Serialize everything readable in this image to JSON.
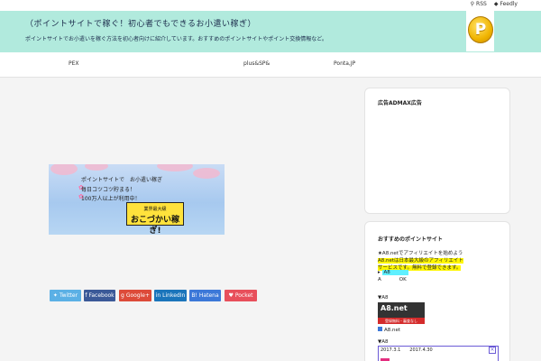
{
  "topbar": {
    "rss_label": "RSS",
    "feedly_label": "Feedly"
  },
  "header": {
    "site_title": "（ポイントサイトで稼ぐ！初心者でもできるお小遣い稼ぎ）",
    "site_description": "ポイントサイトでお小遣いを稼ぐ方法を初心者向けに紹介しています。おすすめのポイントサイトやポイント交換情報など。"
  },
  "nav": {
    "items": [
      "PEX",
      "plus&SP&",
      "Ponta,JP"
    ]
  },
  "banner": {
    "line1": "ポイントサイトで　お小遣い稼ぎ",
    "line2": "毎日コツコツ貯まる！",
    "line3": "100万人以上が利用中！",
    "badge_line1": "業界最大級",
    "badge_line2": "おこづかい稼ぎ!"
  },
  "share": {
    "twitter": "Twitter",
    "facebook": "Facebook",
    "google": "Google+",
    "linkedin": "LinkedIn",
    "hatena": "Hatena",
    "pocket": "Pocket"
  },
  "sidebar": {
    "widget1_title": "広告ADMAX広告",
    "widget2_title": "おすすめのポイントサイト",
    "line1": "★A8.netでアフィリエイトを始めよう",
    "line2": "A8.netは日本最大級のアフィリエイト",
    "line3": "サービスです。無料で登録できます。",
    "line4_prefix": "▸",
    "line4_cyan": "A8",
    "line5_a": "A",
    "line5_b": "OK",
    "a8_label": "▼A8",
    "a8_logo": "A8.net",
    "a8_banner_text": "登録無料・審査なし",
    "a8_link": "A8.net",
    "cal_label": "▼A8",
    "cal_date1": "2017.3.1",
    "cal_date2": "2017.4.30",
    "cal_close": "×"
  },
  "colors": {
    "header_bg": "#b1eadd",
    "twitter": "#5bb0e5",
    "facebook": "#3b5998",
    "google": "#dd4b39",
    "linkedin": "#1b75bb",
    "hatena": "#3c78d8",
    "pocket": "#e84f5b"
  }
}
